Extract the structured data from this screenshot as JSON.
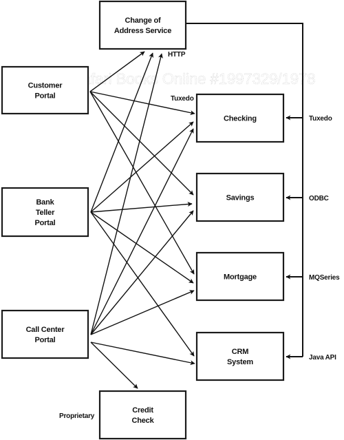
{
  "diagram": {
    "watermark": "Safari Books Online #1997329/1978",
    "colors": {
      "line": "#111111",
      "box_fill": "#ffffff",
      "watermark": "#d8d8d8"
    },
    "nodes": [
      {
        "id": "change-of-address",
        "lines": [
          "Change of",
          "Address Service"
        ]
      },
      {
        "id": "customer-portal",
        "lines": [
          "Customer",
          "Portal"
        ]
      },
      {
        "id": "bank-teller-portal",
        "lines": [
          "Bank",
          "Teller",
          "Portal"
        ]
      },
      {
        "id": "call-center-portal",
        "lines": [
          "Call Center",
          "Portal"
        ]
      },
      {
        "id": "checking",
        "lines": [
          "Checking"
        ]
      },
      {
        "id": "savings",
        "lines": [
          "Savings"
        ]
      },
      {
        "id": "mortgage",
        "lines": [
          "Mortgage"
        ]
      },
      {
        "id": "crm-system",
        "lines": [
          "CRM",
          "System"
        ]
      },
      {
        "id": "credit-check",
        "lines": [
          "Credit",
          "Check"
        ]
      }
    ],
    "edges": [
      {
        "from": "customer-portal",
        "to": "change-of-address"
      },
      {
        "from": "customer-portal",
        "to": "checking"
      },
      {
        "from": "customer-portal",
        "to": "savings"
      },
      {
        "from": "customer-portal",
        "to": "mortgage"
      },
      {
        "from": "bank-teller-portal",
        "to": "change-of-address"
      },
      {
        "from": "bank-teller-portal",
        "to": "checking"
      },
      {
        "from": "bank-teller-portal",
        "to": "savings"
      },
      {
        "from": "bank-teller-portal",
        "to": "mortgage"
      },
      {
        "from": "bank-teller-portal",
        "to": "crm-system"
      },
      {
        "from": "call-center-portal",
        "to": "change-of-address"
      },
      {
        "from": "call-center-portal",
        "to": "checking"
      },
      {
        "from": "call-center-portal",
        "to": "savings"
      },
      {
        "from": "call-center-portal",
        "to": "mortgage"
      },
      {
        "from": "call-center-portal",
        "to": "crm-system"
      },
      {
        "from": "call-center-portal",
        "to": "credit-check"
      }
    ],
    "protocol_labels": {
      "http": "HTTP",
      "tuxedo_left": "Tuxedo",
      "proprietary": "Proprietary"
    },
    "bus": {
      "from": "change-of-address",
      "taps": [
        {
          "to": "checking",
          "label": "Tuxedo"
        },
        {
          "to": "savings",
          "label": "ODBC"
        },
        {
          "to": "mortgage",
          "label": "MQSeries"
        },
        {
          "to": "crm-system",
          "label": "Java API"
        }
      ]
    }
  }
}
